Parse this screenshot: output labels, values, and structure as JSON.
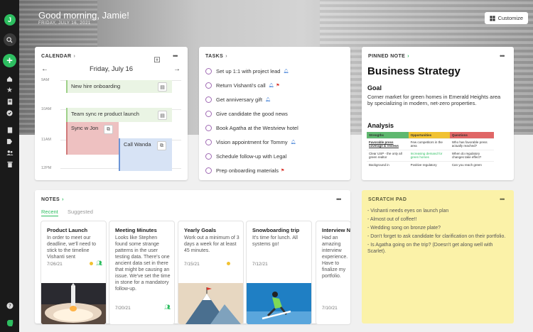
{
  "user": {
    "initial": "J"
  },
  "hero": {
    "greeting": "Good morning, Jamie!",
    "date": "FRIDAY, JULY 16, 2021",
    "customize_label": "Customize"
  },
  "calendar": {
    "heading": "CALENDAR",
    "day": "Friday, July 16",
    "times": [
      "9AM",
      "10AM",
      "11AM",
      "12PM"
    ],
    "events": [
      {
        "title": "New hire onboarding"
      },
      {
        "title": "Team sync re product launch"
      },
      {
        "title": "Sync w Jon"
      },
      {
        "title": "Call Wanda"
      }
    ]
  },
  "tasks": {
    "heading": "TASKS",
    "items": [
      {
        "label": "Set up 1:1 with project lead"
      },
      {
        "label": "Return Vishanti's call"
      },
      {
        "label": "Get anniversary gift"
      },
      {
        "label": "Give candidate the good news"
      },
      {
        "label": "Book Agatha at the Westview hotel"
      },
      {
        "label": "Vision appointment for Tommy"
      },
      {
        "label": "Schedule follow-up with Legal"
      },
      {
        "label": "Prep onboarding materials"
      }
    ]
  },
  "pinned": {
    "heading": "PINNED NOTE",
    "title": "Business Strategy",
    "goal_heading": "Goal",
    "goal_text": "Corner market for green homes in Emerald Heights area by specializing in modern, net-zero properties.",
    "analysis_heading": "Analysis",
    "table": {
      "headers": [
        "Strengths",
        "Opportunities",
        "Questions"
      ],
      "rows": [
        [
          "Favorable press coverage & reviews",
          "Few competitors in the area",
          "Who has favorable press actually reached?"
        ],
        [
          "Clear USP - the only all green realtor",
          "Increasing demand for green homes",
          "When do regulatory changes take effect?"
        ],
        [
          "Background in",
          "Positive regulatory",
          "Can you reach green"
        ]
      ]
    }
  },
  "notes": {
    "heading": "NOTES",
    "tabs": {
      "recent": "Recent",
      "suggested": "Suggested"
    },
    "cards": [
      {
        "title": "Product Launch",
        "body": "In order to meet our deadline, we'll need to stick to the timeline Vishanti sent",
        "date": "7/26/21"
      },
      {
        "title": "Meeting Minutes",
        "body": "Looks like Stephen found some strange patterns in the user testing data. There's one ancient data set in there that might be causing an issue. We've set the time in stone for a mandatory follow-up.",
        "date": "7/20/21"
      },
      {
        "title": "Yearly Goals",
        "body": "Work out a minimum of 3 days a week for at least 45 minutes.",
        "date": "7/15/21"
      },
      {
        "title": "Snowboarding trip",
        "body": "It's time for lunch. All systems go!",
        "date": "7/12/21"
      },
      {
        "title": "Interview N",
        "body": "Had an amazing interview experience. Have to finalize my portfolio.",
        "date": "7/10/21"
      }
    ]
  },
  "scratch": {
    "heading": "SCRATCH PAD",
    "items": [
      "- Vishanti needs eyes on launch plan",
      "- Almost out of coffee!!",
      "- Wedding song on bronze plate?",
      "- Don't forget to ask candidate for clarification on their portfolio.",
      "- Is Agatha going on the trip? (Doesn't get along well with Scarlet)."
    ]
  },
  "colors": {
    "accent": "#2dbe60",
    "task_circle": "#a06ab4",
    "event_green": "#e8f3e2",
    "event_red": "#eec1c1",
    "event_blue": "#d7e3f5",
    "scratch_bg": "#fbf2a8"
  }
}
